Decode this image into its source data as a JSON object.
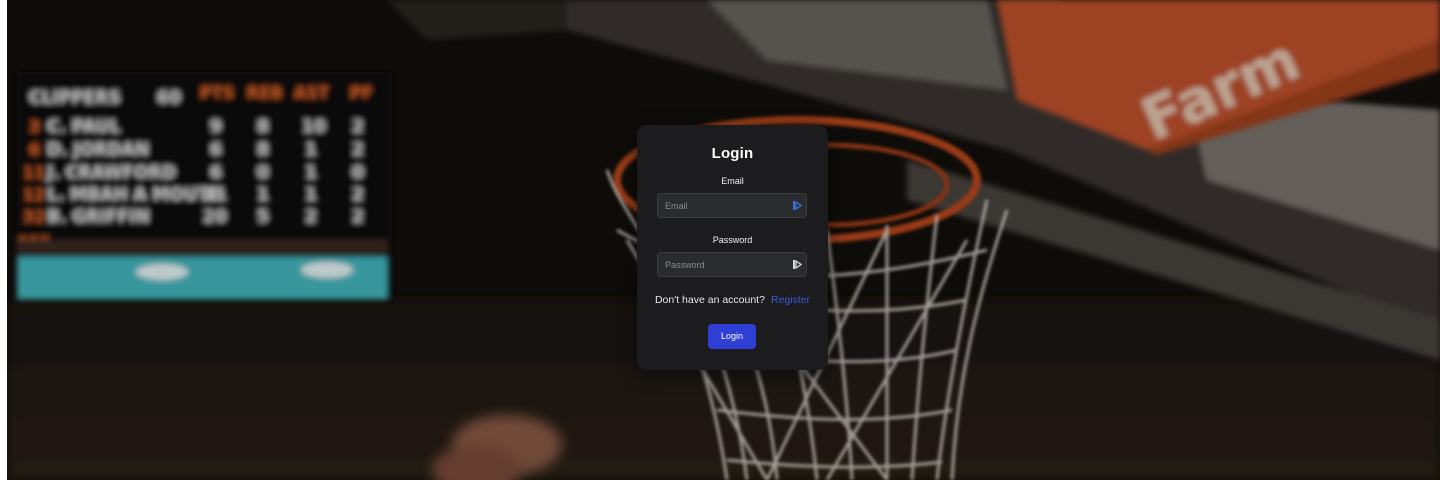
{
  "login": {
    "title": "Login",
    "email_label": "Email",
    "email_placeholder": "Email",
    "email_value": "",
    "password_label": "Password",
    "password_placeholder": "Password",
    "password_value": "",
    "no_account_text": "Don't have an account?",
    "register_link": "Register",
    "submit_label": "Login"
  },
  "icons": {
    "email_field_icon": "autofill-key-icon",
    "password_field_icon": "autofill-key-icon"
  },
  "colors": {
    "card_background": "#1c1c1e",
    "input_background": "#2a2b2e",
    "accent": "#2f3fd6",
    "link": "#3b5bdb"
  }
}
